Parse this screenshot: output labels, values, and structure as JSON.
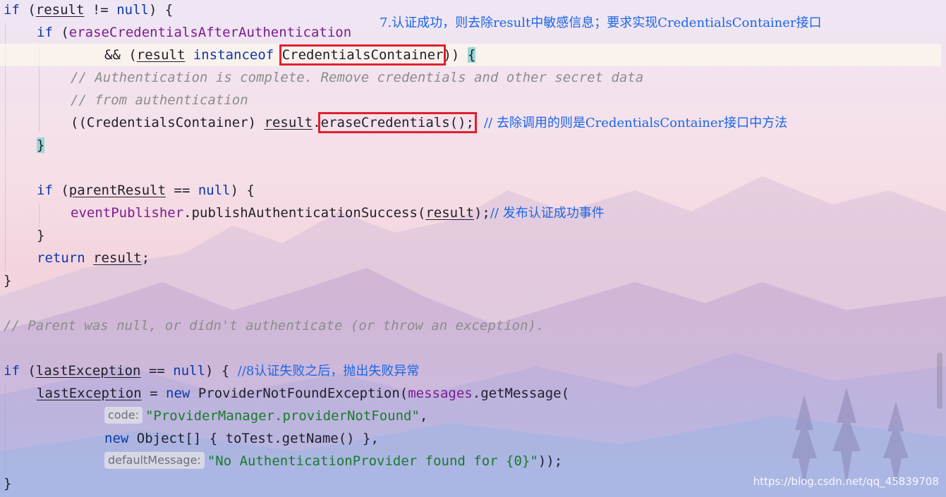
{
  "code": {
    "l1": {
      "if_kw": "if",
      "a": " (",
      "result": "result",
      "b": " != ",
      "null_kw": "null",
      "c": ") {"
    },
    "l2": {
      "if_kw": "if",
      "a": " (",
      "field": "eraseCredentialsAfterAuthentication"
    },
    "l3": {
      "a": "&& (",
      "result": "result",
      "sp": " ",
      "instanceof_kw": "instanceof",
      "sp2": " ",
      "iface": "CredentialsContainer",
      "b": ")) ",
      "brace": "{"
    },
    "l4": {
      "comment": "// Authentication is complete. Remove credentials and other secret data"
    },
    "l5": {
      "comment": "// from authentication"
    },
    "l6": {
      "a": "((CredentialsContainer) ",
      "result": "result",
      "b": ".",
      "call": "eraseCredentials();"
    },
    "l7": {
      "brace": "}"
    },
    "l9": {
      "if_kw": "if",
      "a": " (",
      "parent": "parentResult",
      "b": " == ",
      "null_kw": "null",
      "c": ") {"
    },
    "l10": {
      "publisher": "eventPublisher",
      "a": ".publishAuthenticationSuccess(",
      "result": "result",
      "b": ");"
    },
    "l11": {
      "brace": "}"
    },
    "l12": {
      "return_kw": "return",
      "sp": " ",
      "result": "result",
      "semi": ";"
    },
    "l13": {
      "brace": "}"
    },
    "l15": {
      "comment": "// Parent was null, or didn't authenticate (or throw an exception)."
    },
    "l17": {
      "if_kw": "if",
      "a": " (",
      "lastEx": "lastException",
      "b": " == ",
      "null_kw": "null",
      "c": ") { "
    },
    "l18": {
      "lastEx": "lastException",
      "a": " = ",
      "new_kw": "new",
      "b": " ProviderNotFoundException(",
      "messages": "messages",
      "c": ".getMessage("
    },
    "l19": {
      "hint": "code:",
      "str": "\"ProviderManager.providerNotFound\"",
      "a": ","
    },
    "l20": {
      "new_kw": "new",
      "a": " Object[] { toTest.getName() },"
    },
    "l21": {
      "hint": "defaultMessage:",
      "str": "\"No AuthenticationProvider found for {0}\"",
      "a": "));"
    },
    "l22": {
      "brace": "}"
    }
  },
  "annotations": {
    "top": "7.认证成功，则去除result中敏感信息；要求实现CredentialsContainer接口",
    "erase": "// 去除调用的则是CredentialsContainer接口中方法",
    "publish": "// 发布认证成功事件",
    "fail": "//8认证失败之后，抛出失败异常"
  },
  "watermark": "https://blog.csdn.net/qq_45839708",
  "colors": {
    "keyword": "#0b39a8",
    "field": "#7b1d8f",
    "comment": "#8c8c8c",
    "string": "#1b7a2b",
    "annotation": "#1a66e8",
    "highlight_box": "#e0202c",
    "brace_match": "#9bd6d3"
  }
}
